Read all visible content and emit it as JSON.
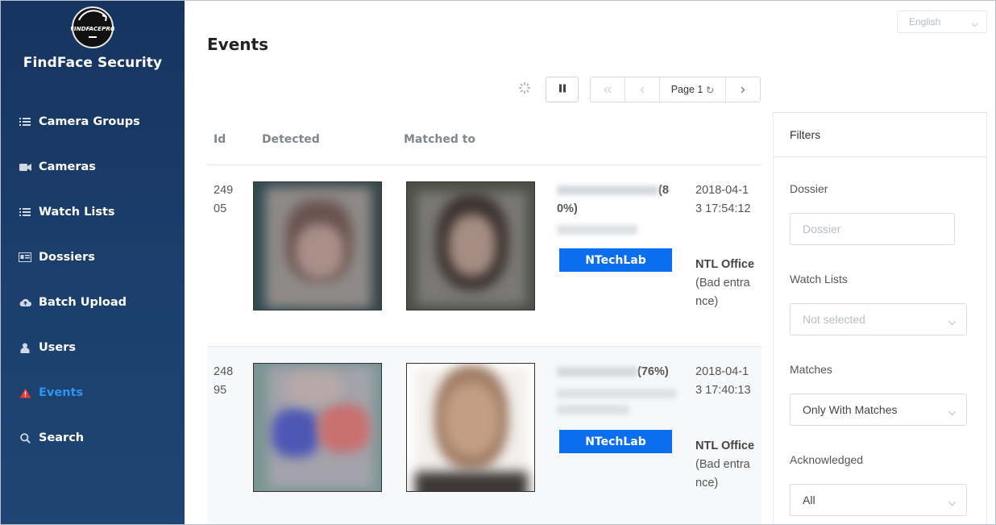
{
  "app": {
    "logo_text": "FINDFACEPRO",
    "title": "FindFace Security"
  },
  "sidebar": {
    "items": [
      {
        "label": "Camera Groups",
        "icon": "list-icon"
      },
      {
        "label": "Cameras",
        "icon": "video-camera-icon"
      },
      {
        "label": "Watch Lists",
        "icon": "list-icon"
      },
      {
        "label": "Dossiers",
        "icon": "id-card-icon"
      },
      {
        "label": "Batch Upload",
        "icon": "cloud-upload-icon"
      },
      {
        "label": "Users",
        "icon": "users-icon"
      },
      {
        "label": "Events",
        "icon": "warning-icon",
        "active": true
      },
      {
        "label": "Search",
        "icon": "search-icon"
      }
    ],
    "active_color": "#2e95f0"
  },
  "header": {
    "page_title": "Events",
    "language": "English"
  },
  "toolbar": {
    "page_label": "Page 1",
    "page_refresh_glyph": "↻"
  },
  "table": {
    "columns": [
      "Id",
      "Detected",
      "Matched to"
    ],
    "rows": [
      {
        "id": "24905",
        "confidence": "(80%)",
        "watch_list": "NTechLab",
        "time": "2018-04-13 17:54:12",
        "camera_name": "NTL Office",
        "camera_detail": "(Bad entrance)"
      },
      {
        "id": "24895",
        "confidence": "(76%)",
        "watch_list": "NTechLab",
        "time": "2018-04-13 17:40:13",
        "camera_name": "NTL Office",
        "camera_detail": "(Bad entrance)"
      }
    ],
    "watch_list_color": "#0a6eee"
  },
  "filters": {
    "title": "Filters",
    "dossier": {
      "label": "Dossier",
      "placeholder": "Dossier"
    },
    "watch_lists": {
      "label": "Watch Lists",
      "value": "Not selected"
    },
    "matches": {
      "label": "Matches",
      "value": "Only With Matches"
    },
    "acknowledged": {
      "label": "Acknowledged",
      "value": "All"
    }
  }
}
